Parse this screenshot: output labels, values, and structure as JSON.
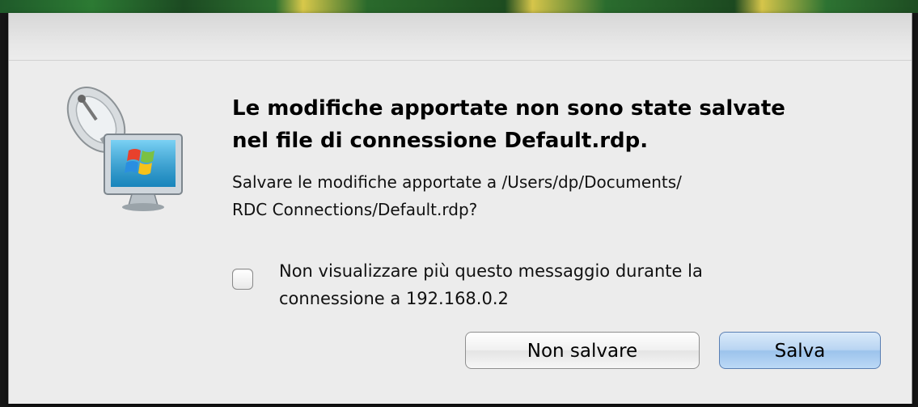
{
  "dialog": {
    "title": "Le modifiche apportate non sono state salvate\nnel file di connessione Default.rdp.",
    "message": "Salvare le modifiche apportate a /Users/dp/Documents/\nRDC Connections/Default.rdp?",
    "checkbox": {
      "label": "Non visualizzare più questo messaggio durante la\nconnessione a 192.168.0.2",
      "checked": false
    },
    "buttons": {
      "dont_save": "Non salvare",
      "save": "Salva"
    },
    "icon": "remote-desktop-connection-icon",
    "default_button_color": "#a9cbef"
  }
}
